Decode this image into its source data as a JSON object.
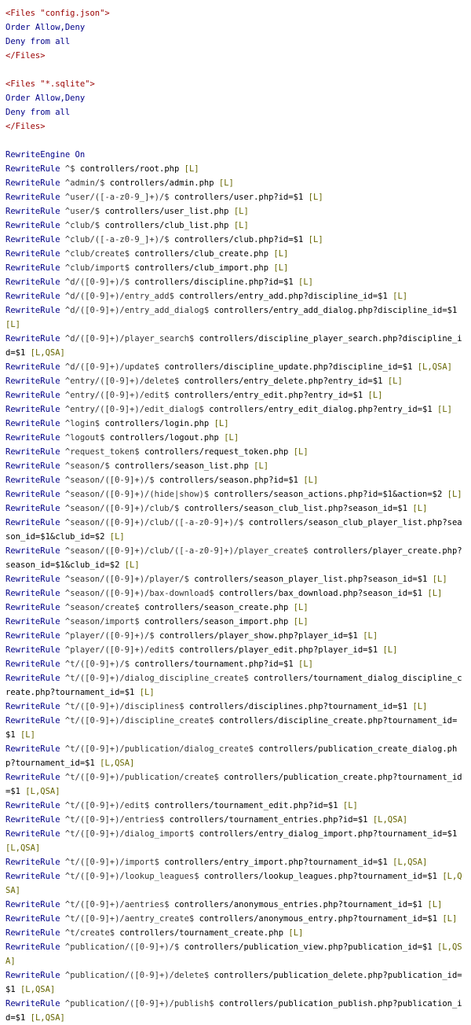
{
  "lines": [
    {
      "kind": "tag",
      "text": "<Files \"config.json\">"
    },
    {
      "kind": "dir",
      "text": "Order Allow,Deny"
    },
    {
      "kind": "dir",
      "text": "Deny from all"
    },
    {
      "kind": "tag",
      "text": "</Files>"
    },
    {
      "kind": "blank",
      "text": ""
    },
    {
      "kind": "tag",
      "text": "<Files \"*.sqlite\">"
    },
    {
      "kind": "dir",
      "text": "Order Allow,Deny"
    },
    {
      "kind": "dir",
      "text": "Deny from all"
    },
    {
      "kind": "tag",
      "text": "</Files>"
    },
    {
      "kind": "blank",
      "text": ""
    },
    {
      "kind": "dir",
      "text": "RewriteEngine On"
    },
    {
      "kind": "rule",
      "pattern": "^$",
      "target": "controllers/root.php",
      "flags": "[L]"
    },
    {
      "kind": "rule",
      "pattern": "^admin/$",
      "target": "controllers/admin.php",
      "flags": "[L]"
    },
    {
      "kind": "rule",
      "pattern": "^user/([-a-z0-9_]+)/$",
      "target": "controllers/user.php?id=$1",
      "flags": "[L]"
    },
    {
      "kind": "rule",
      "pattern": "^user/$",
      "target": "controllers/user_list.php",
      "flags": "[L]"
    },
    {
      "kind": "rule",
      "pattern": "^club/$",
      "target": "controllers/club_list.php",
      "flags": "[L]"
    },
    {
      "kind": "rule",
      "pattern": "^club/([-a-z0-9_]+)/$",
      "target": "controllers/club.php?id=$1",
      "flags": "[L]"
    },
    {
      "kind": "rule",
      "pattern": "^club/create$",
      "target": "controllers/club_create.php",
      "flags": "[L]"
    },
    {
      "kind": "rule",
      "pattern": "^club/import$",
      "target": "controllers/club_import.php",
      "flags": "[L]"
    },
    {
      "kind": "rule",
      "pattern": "^d/([0-9]+)/$",
      "target": "controllers/discipline.php?id=$1",
      "flags": "[L]"
    },
    {
      "kind": "rule",
      "pattern": "^d/([0-9]+)/entry_add$",
      "target": "controllers/entry_add.php?discipline_id=$1",
      "flags": "[L]"
    },
    {
      "kind": "rule",
      "pattern": "^d/([0-9]+)/entry_add_dialog$",
      "target": "controllers/entry_add_dialog.php?discipline_id=$1",
      "flags": "[L]"
    },
    {
      "kind": "rule",
      "pattern": "^d/([0-9]+)/player_search$",
      "target": "controllers/discipline_player_search.php?discipline_id=$1",
      "flags": "[L,QSA]"
    },
    {
      "kind": "rule",
      "pattern": "^d/([0-9]+)/update$",
      "target": "controllers/discipline_update.php?discipline_id=$1",
      "flags": "[L,QSA]"
    },
    {
      "kind": "rule",
      "pattern": "^entry/([0-9]+)/delete$",
      "target": "controllers/entry_delete.php?entry_id=$1",
      "flags": "[L]"
    },
    {
      "kind": "rule",
      "pattern": "^entry/([0-9]+)/edit$",
      "target": "controllers/entry_edit.php?entry_id=$1",
      "flags": "[L]"
    },
    {
      "kind": "rule",
      "pattern": "^entry/([0-9]+)/edit_dialog$",
      "target": "controllers/entry_edit_dialog.php?entry_id=$1",
      "flags": "[L]"
    },
    {
      "kind": "rule",
      "pattern": "^login$",
      "target": "controllers/login.php",
      "flags": "[L]"
    },
    {
      "kind": "rule",
      "pattern": "^logout$",
      "target": "controllers/logout.php",
      "flags": "[L]"
    },
    {
      "kind": "rule",
      "pattern": "^request_token$",
      "target": "controllers/request_token.php",
      "flags": "[L]"
    },
    {
      "kind": "rule",
      "pattern": "^season/$",
      "target": "controllers/season_list.php",
      "flags": "[L]"
    },
    {
      "kind": "rule",
      "pattern": "^season/([0-9]+)/$",
      "target": "controllers/season.php?id=$1",
      "flags": "[L]"
    },
    {
      "kind": "rule",
      "pattern": "^season/([0-9]+)/(hide|show)$",
      "target": "controllers/season_actions.php?id=$1&action=$2",
      "flags": "[L]"
    },
    {
      "kind": "rule",
      "pattern": "^season/([0-9]+)/club/$",
      "target": "controllers/season_club_list.php?season_id=$1",
      "flags": "[L]"
    },
    {
      "kind": "rule",
      "pattern": "^season/([0-9]+)/club/([-a-z0-9]+)/$",
      "target": "controllers/season_club_player_list.php?season_id=$1&club_id=$2",
      "flags": "[L]"
    },
    {
      "kind": "rule",
      "pattern": "^season/([0-9]+)/club/([-a-z0-9]+)/player_create$",
      "target": "controllers/player_create.php?season_id=$1&club_id=$2",
      "flags": "[L]"
    },
    {
      "kind": "rule",
      "pattern": "^season/([0-9]+)/player/$",
      "target": "controllers/season_player_list.php?season_id=$1",
      "flags": "[L]"
    },
    {
      "kind": "rule",
      "pattern": "^season/([0-9]+)/bax-download$",
      "target": "controllers/bax_download.php?season_id=$1",
      "flags": "[L]"
    },
    {
      "kind": "rule",
      "pattern": "^season/create$",
      "target": "controllers/season_create.php",
      "flags": "[L]"
    },
    {
      "kind": "rule",
      "pattern": "^season/import$",
      "target": "controllers/season_import.php",
      "flags": "[L]"
    },
    {
      "kind": "rule",
      "pattern": "^player/([0-9]+)/$",
      "target": "controllers/player_show.php?player_id=$1",
      "flags": "[L]"
    },
    {
      "kind": "rule",
      "pattern": "^player/([0-9]+)/edit$",
      "target": "controllers/player_edit.php?player_id=$1",
      "flags": "[L]"
    },
    {
      "kind": "rule",
      "pattern": "^t/([0-9]+)/$",
      "target": "controllers/tournament.php?id=$1",
      "flags": "[L]"
    },
    {
      "kind": "rule",
      "pattern": "^t/([0-9]+)/dialog_discipline_create$",
      "target": "controllers/tournament_dialog_discipline_create.php?tournament_id=$1",
      "flags": "[L]"
    },
    {
      "kind": "rule",
      "pattern": "^t/([0-9]+)/disciplines$",
      "target": "controllers/disciplines.php?tournament_id=$1",
      "flags": "[L]"
    },
    {
      "kind": "rule",
      "pattern": "^t/([0-9]+)/discipline_create$",
      "target": "controllers/discipline_create.php?tournament_id=$1",
      "flags": "[L]"
    },
    {
      "kind": "rule",
      "pattern": "^t/([0-9]+)/publication/dialog_create$",
      "target": "controllers/publication_create_dialog.php?tournament_id=$1",
      "flags": "[L,QSA]"
    },
    {
      "kind": "rule",
      "pattern": "^t/([0-9]+)/publication/create$",
      "target": "controllers/publication_create.php?tournament_id=$1",
      "flags": "[L,QSA]"
    },
    {
      "kind": "rule",
      "pattern": "^t/([0-9]+)/edit$",
      "target": "controllers/tournament_edit.php?id=$1",
      "flags": "[L]"
    },
    {
      "kind": "rule",
      "pattern": "^t/([0-9]+)/entries$",
      "target": "controllers/tournament_entries.php?id=$1",
      "flags": "[L,QSA]"
    },
    {
      "kind": "rule",
      "pattern": "^t/([0-9]+)/dialog_import$",
      "target": "controllers/entry_dialog_import.php?tournament_id=$1",
      "flags": "[L,QSA]"
    },
    {
      "kind": "rule",
      "pattern": "^t/([0-9]+)/import$",
      "target": "controllers/entry_import.php?tournament_id=$1",
      "flags": "[L,QSA]"
    },
    {
      "kind": "rule",
      "pattern": "^t/([0-9]+)/lookup_leagues$",
      "target": "controllers/lookup_leagues.php?tournament_id=$1",
      "flags": "[L,QSA]"
    },
    {
      "kind": "rule",
      "pattern": "^t/([0-9]+)/aentries$",
      "target": "controllers/anonymous_entries.php?tournament_id=$1",
      "flags": "[L]"
    },
    {
      "kind": "rule",
      "pattern": "^t/([0-9]+)/aentry_create$",
      "target": "controllers/anonymous_entry.php?tournament_id=$1",
      "flags": "[L]"
    },
    {
      "kind": "rule",
      "pattern": "^t/create$",
      "target": "controllers/tournament_create.php",
      "flags": "[L]"
    },
    {
      "kind": "rule",
      "pattern": "^publication/([0-9]+)/$",
      "target": "controllers/publication_view.php?publication_id=$1",
      "flags": "[L,QSA]"
    },
    {
      "kind": "rule",
      "pattern": "^publication/([0-9]+)/delete$",
      "target": "controllers/publication_delete.php?publication_id=$1",
      "flags": "[L,QSA]"
    },
    {
      "kind": "rule",
      "pattern": "^publication/([0-9]+)/publish$",
      "target": "controllers/publication_publish.php?publication_id=$1",
      "flags": "[L,QSA]"
    }
  ],
  "keyword": "RewriteRule"
}
